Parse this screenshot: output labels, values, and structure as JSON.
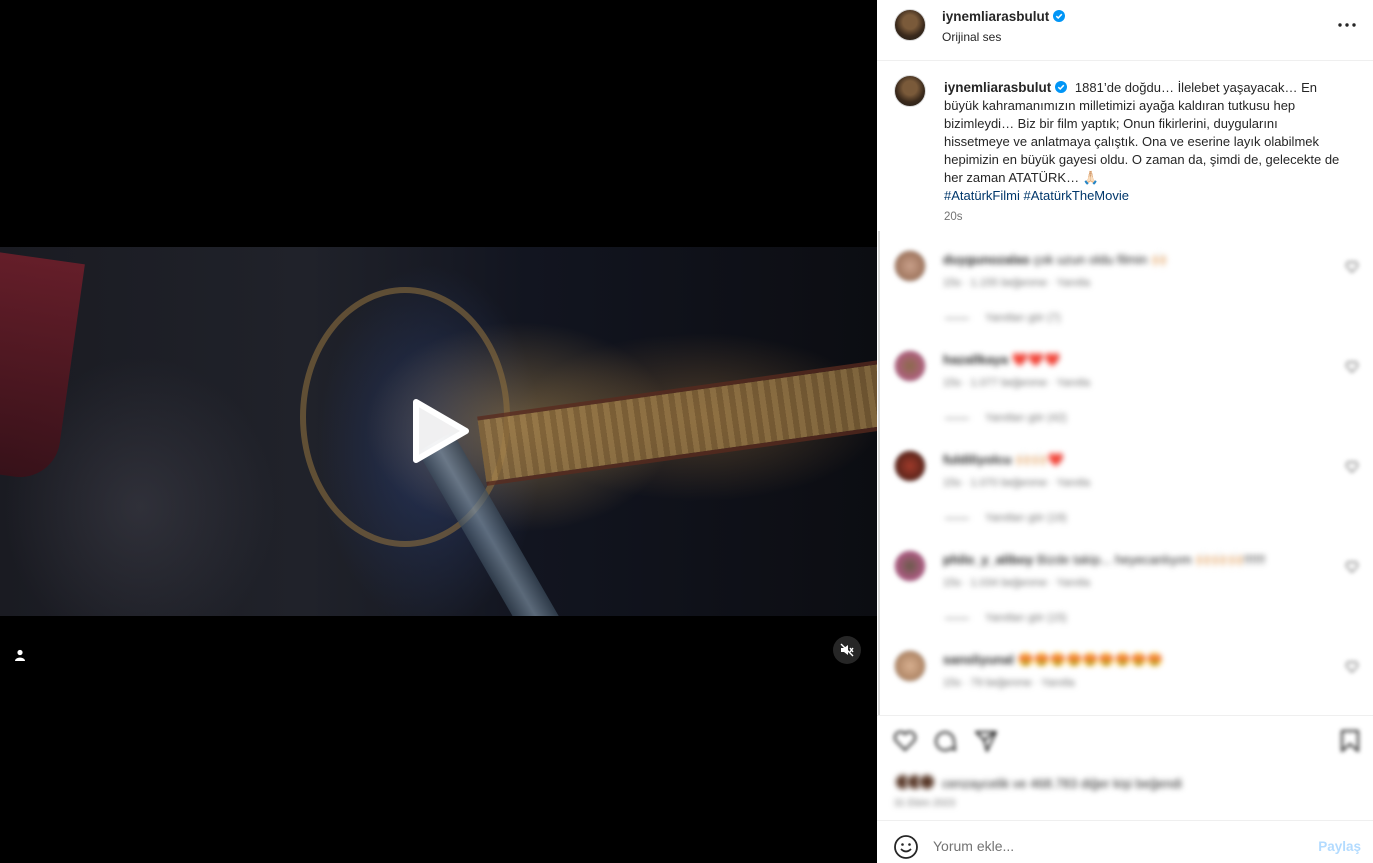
{
  "post": {
    "username": "iynemliarasbulut",
    "audio_label": "Orijinal ses",
    "caption": "1881’de doğdu… İlelebet yaşayacak… En büyük kahramanımızın milletimizi ayağa kaldıran tutkusu hep bizimleydi… Biz bir film yaptık; Onun fikirlerini, duygularını hissetmeye ve anlatmaya çalıştık. Ona ve eserine layık olabilmek hepimizin en büyük gayesi oldu. O zaman da, şimdi de, gelecekte de her zaman ATATÜRK… 🙏🏻",
    "hashtags": [
      "#AtatürkFilmi",
      "#AtatürkTheMovie"
    ],
    "time_ago": "20s"
  },
  "comments": [
    {
      "username": "duygunozalas",
      "text": "çok uzun oldu filmin 🙌🏻",
      "meta": "15s · 1.155 beğenme · Yanıtla",
      "replies": "Yanıtları gör (7)"
    },
    {
      "username": "hazallkaya",
      "text": "❤️❤️❤️",
      "meta": "15s · 1.077 beğenme · Yanıtla",
      "replies": "Yanıtları gör (42)"
    },
    {
      "username": "fuldiliyolcu",
      "text": "🙌🏻🙌🏻❤️",
      "meta": "15s · 1.070 beğenme · Yanıtla",
      "replies": "Yanıtları gör (19)"
    },
    {
      "username": "philo_y_aliboy",
      "text": "Bizde takip... heyecanlıyım 🙌🏻🙌🏻🙌🏻!!!!!!",
      "meta": "15s · 1.034 beğenme · Yanıtla",
      "replies": "Yanıtları gör (15)"
    },
    {
      "username": "sansliyunal",
      "text": "😍😍😍😍😍😍😍😍😍",
      "meta": "15s · 79 beğenme · Yanıtla",
      "replies": ""
    }
  ],
  "actions": {
    "likes_text": "cenzaycelik ve 468.783 diğer kişi beğendi",
    "date_text": "31 Ekim 2023"
  },
  "composer": {
    "placeholder": "Yorum ekle...",
    "share_label": "Paylaş"
  },
  "icons": {
    "play": "play-icon",
    "user_tag": "user-tag-icon",
    "mute": "muted-speaker-icon",
    "more": "more-options-icon",
    "verified": "verified-badge-icon",
    "like": "heart-icon",
    "comment": "comment-bubble-icon",
    "share": "paper-plane-icon",
    "save": "bookmark-icon",
    "emoji": "emoji-icon"
  },
  "colors": {
    "verified": "#0095f6",
    "hashtag": "#00376b",
    "share_disabled": "#b3dbff",
    "reaction_heart": "#ed4956"
  }
}
